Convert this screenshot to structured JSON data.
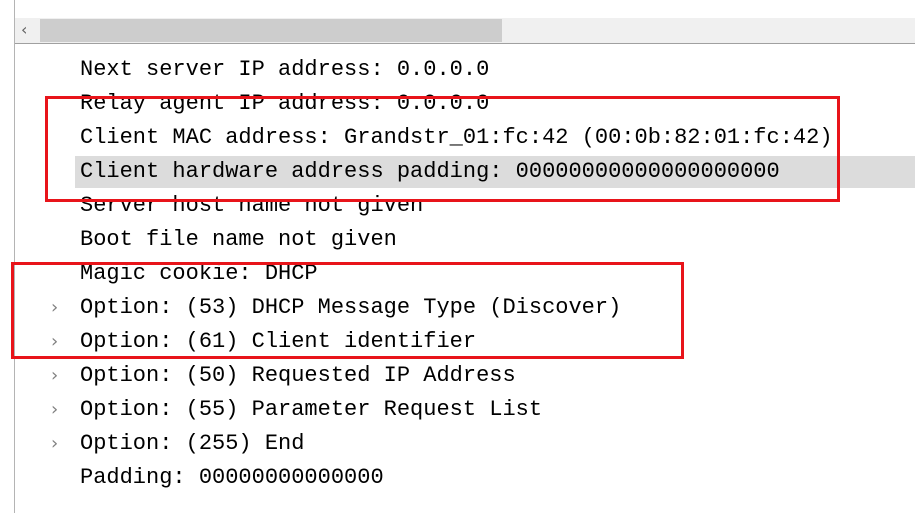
{
  "scrollbar": {
    "left_arrow_icon": "chevron-left-icon"
  },
  "rows": [
    {
      "text": "Next server IP address: 0.0.0.0",
      "expandable": false,
      "selected": false
    },
    {
      "text": "Relay agent IP address: 0.0.0.0",
      "expandable": false,
      "selected": false
    },
    {
      "text": "Client MAC address: Grandstr_01:fc:42 (00:0b:82:01:fc:42)",
      "expandable": false,
      "selected": false
    },
    {
      "text": "Client hardware address padding: 00000000000000000000",
      "expandable": false,
      "selected": true
    },
    {
      "text": "Server host name not given",
      "expandable": false,
      "selected": false
    },
    {
      "text": "Boot file name not given",
      "expandable": false,
      "selected": false
    },
    {
      "text": "Magic cookie: DHCP",
      "expandable": false,
      "selected": false
    },
    {
      "text": "Option: (53) DHCP Message Type (Discover)",
      "expandable": true,
      "selected": false
    },
    {
      "text": "Option: (61) Client identifier",
      "expandable": true,
      "selected": false
    },
    {
      "text": "Option: (50) Requested IP Address",
      "expandable": true,
      "selected": false
    },
    {
      "text": "Option: (55) Parameter Request List",
      "expandable": true,
      "selected": false
    },
    {
      "text": "Option: (255) End",
      "expandable": true,
      "selected": false
    },
    {
      "text": "Padding: 00000000000000",
      "expandable": false,
      "selected": false
    }
  ],
  "colors": {
    "highlight_box": "#e8141a",
    "selected_row": "#dcdcdc"
  }
}
